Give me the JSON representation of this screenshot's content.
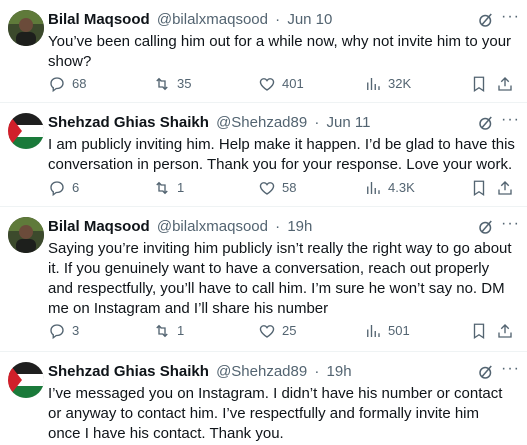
{
  "colors": {
    "text": "#0f1419",
    "secondary": "#536471",
    "divider": "#eff3f4"
  },
  "tweets": [
    {
      "name": "Bilal Maqsood",
      "handle": "@bilalxmaqsood",
      "sep": "·",
      "time": "Jun 10",
      "text": "You’ve been calling him out for a while now, why not invite him to your show?",
      "replies": "68",
      "reposts": "35",
      "likes": "401",
      "views": "32K",
      "avatar": "bilal-avatar"
    },
    {
      "name": "Shehzad Ghias Shaikh",
      "handle": "@Shehzad89",
      "sep": "·",
      "time": "Jun 11",
      "text": "I am publicly inviting him. Help make it happen. I’d be glad to have this conversation in person. Thank you for your response. Love your work.",
      "replies": "6",
      "reposts": "1",
      "likes": "58",
      "views": "4.3K",
      "avatar": "shehzad-avatar"
    },
    {
      "name": "Bilal Maqsood",
      "handle": "@bilalxmaqsood",
      "sep": "·",
      "time": "19h",
      "text": "Saying you’re inviting him publicly isn’t really the right way to go about it. If you genuinely want to have a conversation, reach out properly and respectfully, you’ll have to call him. I’m sure he won’t say no. DM me on Instagram and I’ll share his number",
      "replies": "3",
      "reposts": "1",
      "likes": "25",
      "views": "501",
      "avatar": "bilal-avatar"
    },
    {
      "name": "Shehzad Ghias Shaikh",
      "handle": "@Shehzad89",
      "sep": "·",
      "time": "19h",
      "text": "I’ve messaged you on Instagram. I didn’t have his number or contact or anyway to contact him. I’ve respectfully and formally invite him once I have his contact. Thank you.",
      "avatar": "shehzad-avatar"
    }
  ]
}
